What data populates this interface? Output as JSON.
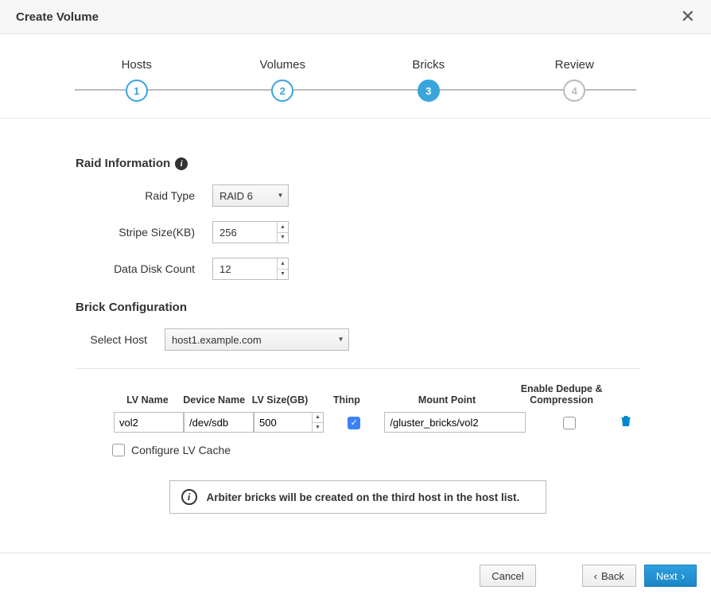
{
  "header": {
    "title": "Create Volume"
  },
  "wizard": {
    "steps": [
      {
        "label": "Hosts",
        "num": "1",
        "state": "done"
      },
      {
        "label": "Volumes",
        "num": "2",
        "state": "done"
      },
      {
        "label": "Bricks",
        "num": "3",
        "state": "active"
      },
      {
        "label": "Review",
        "num": "4",
        "state": "upcoming"
      }
    ]
  },
  "raid": {
    "section_title": "Raid Information",
    "type_label": "Raid Type",
    "type_value": "RAID 6",
    "stripe_label": "Stripe Size(KB)",
    "stripe_value": "256",
    "disk_count_label": "Data Disk Count",
    "disk_count_value": "12"
  },
  "brick": {
    "section_title": "Brick Configuration",
    "select_host_label": "Select Host",
    "select_host_value": "host1.example.com",
    "columns": {
      "lv": "LV Name",
      "dev": "Device Name",
      "size": "LV Size(GB)",
      "thinp": "Thinp",
      "mount": "Mount Point",
      "dedup": "Enable Dedupe & Compression"
    },
    "rows": [
      {
        "lv": "vol2",
        "dev": "/dev/sdb",
        "size": "500",
        "thinp": true,
        "mount": "/gluster_bricks/vol2",
        "dedup": false
      }
    ],
    "lvcache_label": "Configure LV Cache",
    "lvcache_checked": false,
    "alert_text": "Arbiter bricks will be created on the third host in the host list."
  },
  "footer": {
    "cancel": "Cancel",
    "back": "Back",
    "next": "Next"
  }
}
